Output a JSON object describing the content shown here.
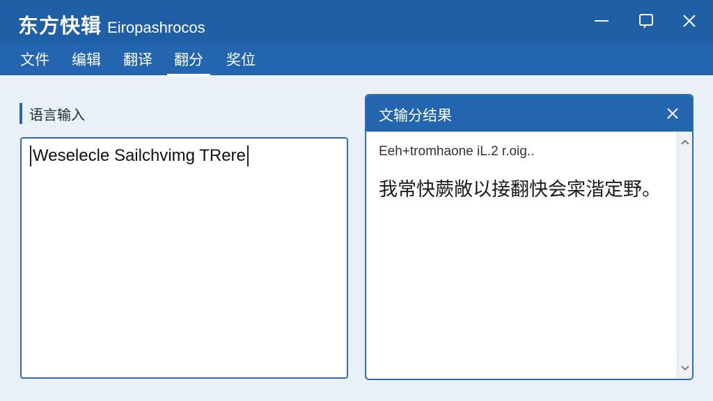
{
  "app": {
    "title_cn": "东方快辑",
    "title_en": "Eiropashrocos"
  },
  "window_controls": {
    "minimize": "minimize-icon",
    "maximize": "maximize-icon",
    "close": "close-icon"
  },
  "menu": {
    "items": [
      {
        "label": "文件"
      },
      {
        "label": "编辑"
      },
      {
        "label": "翻译"
      },
      {
        "label": "翻分"
      },
      {
        "label": "奖位"
      }
    ],
    "active_index": 3
  },
  "input_panel": {
    "label": "语言输入",
    "value": "Weselecle Sailchvimg TRere"
  },
  "result_panel": {
    "title": "文输分结果",
    "subtitle": "Eeh+tromhaone iL.2 r.oig..",
    "text": "我常快蕨敞以接翻快会寀湝定野。"
  },
  "colors": {
    "titlebar": "#1f5fa6",
    "menubar": "#2466ad",
    "accent": "#2f6db0",
    "background": "#e9f0f8"
  }
}
